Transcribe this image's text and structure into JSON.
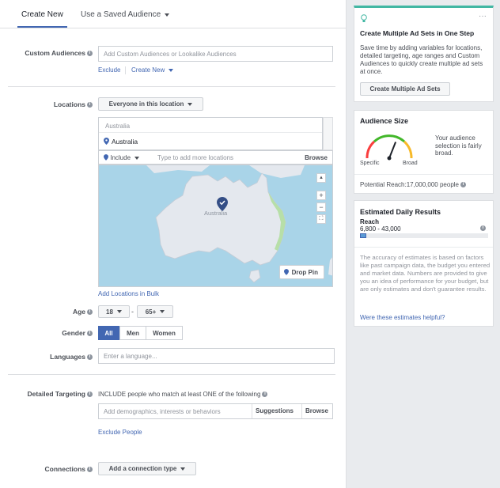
{
  "tabs": {
    "create_new": "Create New",
    "saved_audience": "Use a Saved Audience"
  },
  "custom_audiences": {
    "label": "Custom Audiences",
    "placeholder": "Add Custom Audiences or Lookalike Audiences",
    "exclude": "Exclude",
    "create_new": "Create New"
  },
  "locations": {
    "label": "Locations",
    "dropdown": "Everyone in this location",
    "group_header": "Australia",
    "selected": "Australia",
    "include": "Include",
    "placeholder": "Type to add more locations",
    "browse": "Browse",
    "map_label": "Australia",
    "drop_pin": "Drop Pin",
    "bulk": "Add Locations in Bulk",
    "zoom_in": "+",
    "zoom_out": "−"
  },
  "age": {
    "label": "Age",
    "min": "18",
    "dash": "-",
    "max": "65+"
  },
  "gender": {
    "label": "Gender",
    "all": "All",
    "men": "Men",
    "women": "Women"
  },
  "languages": {
    "label": "Languages",
    "placeholder": "Enter a language..."
  },
  "detailed_targeting": {
    "label": "Detailed Targeting",
    "description": "INCLUDE people who match at least ONE of the following",
    "placeholder": "Add demographics, interests or behaviors",
    "suggestions": "Suggestions",
    "browse": "Browse",
    "exclude": "Exclude People"
  },
  "connections": {
    "label": "Connections",
    "button": "Add a connection type"
  },
  "tip_card": {
    "title": "Create Multiple Ad Sets in One Step",
    "body": "Save time by adding variables for locations, detailed targeting, age ranges and Custom Audiences to quickly create multiple ad sets at once.",
    "button": "Create Multiple Ad Sets",
    "more": "···"
  },
  "audience_size": {
    "title": "Audience Size",
    "specific": "Specific",
    "broad": "Broad",
    "description": "Your audience selection is fairly broad.",
    "reach": "Potential Reach:17,000,000 people",
    "gauge_level": 0.62
  },
  "daily_results": {
    "title": "Estimated Daily Results",
    "reach_label": "Reach",
    "reach_range": "6,800 - 43,000",
    "bar_fraction": 0.05,
    "note": "The accuracy of estimates is based on factors like past campaign data, the budget you entered and market data. Numbers are provided to give you an idea of performance for your budget, but are only estimates and don't guarantee results.",
    "helpful": "Were these estimates helpful?"
  },
  "colors": {
    "accent": "#4267b2",
    "teal": "#42b7a3",
    "gauge_green": "#42b72a",
    "gauge_yellow": "#f7b928",
    "map_land": "#e4e8ee",
    "map_water": "#a9d4e8"
  }
}
